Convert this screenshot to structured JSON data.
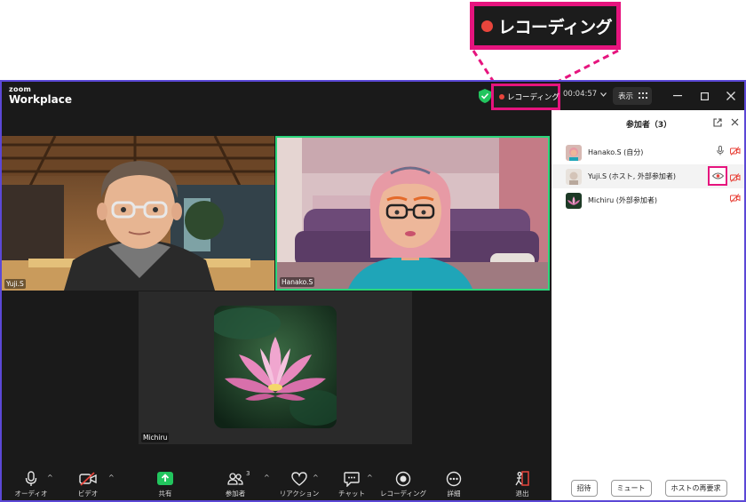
{
  "callout": {
    "label": "レコーディング"
  },
  "app": {
    "logo_line1": "zoom",
    "logo_line2": "Workplace"
  },
  "titlebar": {
    "recording_label": "レコーディング",
    "timer": "00:04:57",
    "view_label": "表示"
  },
  "tiles": {
    "yuji": "Yuji.S",
    "hanako": "Hanako.S",
    "michiru": "Michiru"
  },
  "toolbar": {
    "audio": "オーディオ",
    "video": "ビデオ",
    "share": "共有",
    "participants": "参加者",
    "participants_count": "3",
    "reactions": "リアクション",
    "chat": "チャット",
    "recording": "レコーディング",
    "details": "詳細",
    "leave": "退出"
  },
  "panel": {
    "title": "参加者（3）",
    "participants": [
      {
        "name": "Hanako.S (自分)"
      },
      {
        "name": "Yuji.S (ホスト, 外部参加者)"
      },
      {
        "name": "Michiru (外部参加者)"
      }
    ],
    "footer": {
      "invite": "招待",
      "mute": "ミュート",
      "reclaim_host": "ホストの再要求"
    }
  },
  "colors": {
    "highlight": "#e6147e",
    "record_red": "#e8453c",
    "active_speaker": "#2bd67b",
    "window_border": "#5b48d6",
    "share_green": "#22c55e"
  }
}
